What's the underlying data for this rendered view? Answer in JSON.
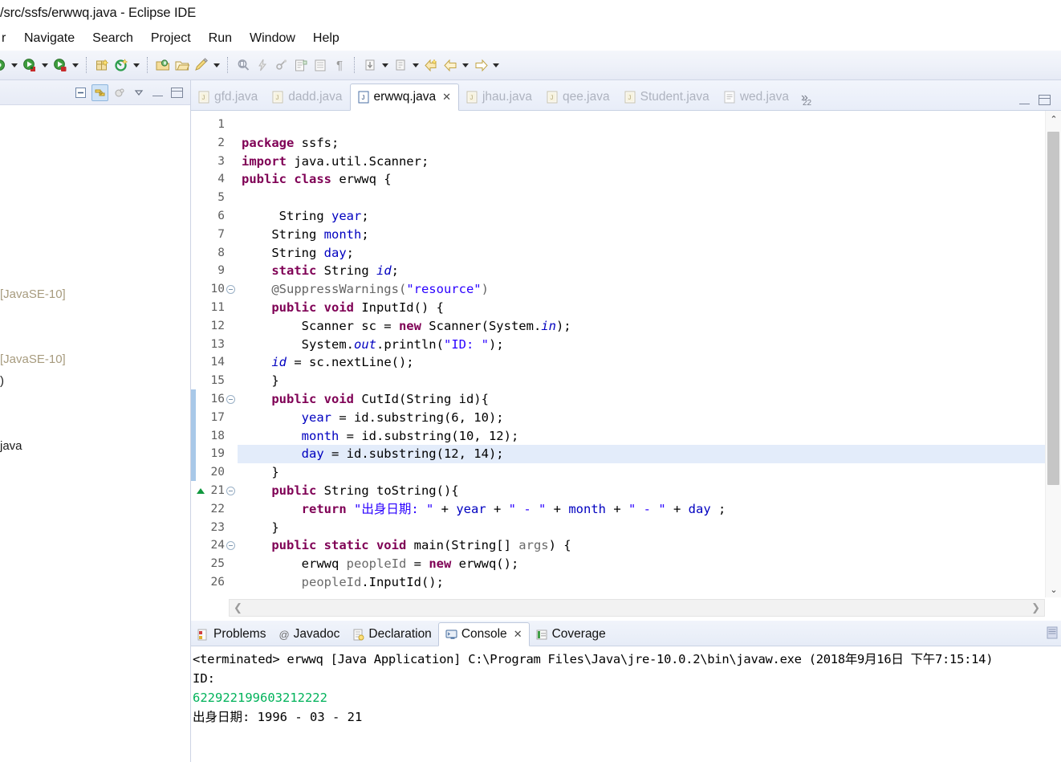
{
  "window": {
    "title": "/src/ssfs/erwwq.java - Eclipse IDE"
  },
  "menubar": {
    "clipped_item": "r",
    "items": [
      {
        "label": "Navigate",
        "name": "menu-navigate"
      },
      {
        "label": "Search",
        "name": "menu-search"
      },
      {
        "label": "Project",
        "name": "menu-project"
      },
      {
        "label": "Run",
        "name": "menu-run"
      },
      {
        "label": "Window",
        "name": "menu-window"
      },
      {
        "label": "Help",
        "name": "menu-help"
      }
    ]
  },
  "toolbar": {
    "icons": [
      "debug-icon",
      "dropdown-arrow",
      "run-icon",
      "dropdown-arrow",
      "run-last-tool-icon",
      "dropdown-arrow",
      "new-package-icon",
      "new-java-class-icon",
      "dropdown-arrow",
      "open-type-icon",
      "open-resource-icon",
      "external-tools-icon",
      "dropdown-arrow",
      "search-icon",
      "lightning-icon",
      "link-icon",
      "next-annotation-icon",
      "previous-annotation-icon",
      "pilcrow-icon",
      "last-edit-location-icon",
      "dropdown-arrow",
      "next-edit-icon",
      "dropdown-arrow",
      "back-icon",
      "forward-back-icon",
      "dropdown-arrow",
      "forward-icon",
      "dropdown-arrow"
    ]
  },
  "left_view": {
    "toolbar_icons": [
      {
        "name": "collapse-all-icon",
        "active": false
      },
      {
        "name": "link-with-editor-icon",
        "active": true
      },
      {
        "name": "focus-on-active-task-icon",
        "active": false
      },
      {
        "name": "view-menu-icon",
        "active": false
      },
      {
        "name": "minimize-icon",
        "active": false
      },
      {
        "name": "maximize-icon",
        "active": false
      }
    ],
    "tree_rows": [
      {
        "label": "",
        "dim": true
      },
      {
        "label": "",
        "dim": true
      },
      {
        "label": "",
        "dim": true
      },
      {
        "label": "",
        "dim": true
      },
      {
        "label": "",
        "dim": true
      },
      {
        "label": "",
        "dim": true
      },
      {
        "label": "",
        "dim": true
      },
      {
        "label": "",
        "dim": true
      },
      {
        "label": "[JavaSE-10]",
        "dim": true
      },
      {
        "label": "",
        "dim": true
      },
      {
        "label": "",
        "dim": true
      },
      {
        "label": "[JavaSE-10]",
        "dim": true
      },
      {
        "label": ")",
        "dim": false
      },
      {
        "label": "",
        "dim": true
      },
      {
        "label": "",
        "dim": true
      },
      {
        "label": "java",
        "dim": false
      }
    ]
  },
  "editor": {
    "tabs": [
      {
        "label": "gfd.java",
        "icon": "java-file-icon",
        "active": false,
        "closeable": false
      },
      {
        "label": "dadd.java",
        "icon": "java-file-icon",
        "active": false,
        "closeable": false
      },
      {
        "label": "erwwq.java",
        "icon": "java-file-icon",
        "active": true,
        "closeable": true,
        "close_glyph": "✕"
      },
      {
        "label": "jhau.java",
        "icon": "java-file-icon",
        "active": false,
        "closeable": false
      },
      {
        "label": "qee.java",
        "icon": "java-file-icon",
        "active": false,
        "closeable": false
      },
      {
        "label": "Student.java",
        "icon": "java-file-icon",
        "active": false,
        "closeable": false
      },
      {
        "label": "wed.java",
        "icon": "text-file-icon",
        "active": false,
        "closeable": false
      }
    ],
    "overflow_label": "»",
    "overflow_count": "22",
    "minimize_icon": "minimize-icon",
    "maximize_icon": "maximize-icon",
    "highlighted_line": 19,
    "change_bar_lines": [
      16,
      17,
      18,
      19,
      20
    ],
    "folding_lines": [
      10,
      16,
      21,
      24
    ],
    "marker_line": 21,
    "lines": [
      {
        "n": 1,
        "tokens": []
      },
      {
        "n": 2,
        "tokens": [
          {
            "t": "kw",
            "v": "package"
          },
          {
            "t": "p",
            "v": " ssfs;"
          }
        ]
      },
      {
        "n": 3,
        "tokens": [
          {
            "t": "kw",
            "v": "import"
          },
          {
            "t": "p",
            "v": " java.util.Scanner;"
          }
        ]
      },
      {
        "n": 4,
        "tokens": [
          {
            "t": "kw",
            "v": "public class"
          },
          {
            "t": "p",
            "v": " erwwq {"
          }
        ]
      },
      {
        "n": 5,
        "tokens": []
      },
      {
        "n": 6,
        "tokens": [
          {
            "t": "p",
            "v": "     String "
          },
          {
            "t": "fld",
            "v": "year"
          },
          {
            "t": "p",
            "v": ";"
          }
        ]
      },
      {
        "n": 7,
        "tokens": [
          {
            "t": "p",
            "v": "    String "
          },
          {
            "t": "fld",
            "v": "month"
          },
          {
            "t": "p",
            "v": ";"
          }
        ]
      },
      {
        "n": 8,
        "tokens": [
          {
            "t": "p",
            "v": "    String "
          },
          {
            "t": "fld",
            "v": "day"
          },
          {
            "t": "p",
            "v": ";"
          }
        ]
      },
      {
        "n": 9,
        "tokens": [
          {
            "t": "p",
            "v": "    "
          },
          {
            "t": "kw",
            "v": "static"
          },
          {
            "t": "p",
            "v": " String "
          },
          {
            "t": "fldi",
            "v": "id"
          },
          {
            "t": "p",
            "v": ";"
          }
        ]
      },
      {
        "n": 10,
        "tokens": [
          {
            "t": "p",
            "v": "    "
          },
          {
            "t": "anno",
            "v": "@SuppressWarnings("
          },
          {
            "t": "str",
            "v": "\"resource\""
          },
          {
            "t": "anno",
            "v": ")"
          }
        ]
      },
      {
        "n": 11,
        "tokens": [
          {
            "t": "p",
            "v": "    "
          },
          {
            "t": "kw",
            "v": "public void"
          },
          {
            "t": "p",
            "v": " InputId() {"
          }
        ]
      },
      {
        "n": 12,
        "tokens": [
          {
            "t": "p",
            "v": "        Scanner sc = "
          },
          {
            "t": "kw",
            "v": "new"
          },
          {
            "t": "p",
            "v": " Scanner(System."
          },
          {
            "t": "fldi",
            "v": "in"
          },
          {
            "t": "p",
            "v": ");"
          }
        ]
      },
      {
        "n": 13,
        "tokens": [
          {
            "t": "p",
            "v": "        System."
          },
          {
            "t": "fldi",
            "v": "out"
          },
          {
            "t": "p",
            "v": ".println("
          },
          {
            "t": "str",
            "v": "\"ID: \""
          },
          {
            "t": "p",
            "v": ");"
          }
        ]
      },
      {
        "n": 14,
        "tokens": [
          {
            "t": "p",
            "v": "    "
          },
          {
            "t": "fldi",
            "v": "id"
          },
          {
            "t": "p",
            "v": " = sc.nextLine();"
          }
        ]
      },
      {
        "n": 15,
        "tokens": [
          {
            "t": "p",
            "v": "    }"
          }
        ]
      },
      {
        "n": 16,
        "tokens": [
          {
            "t": "p",
            "v": "    "
          },
          {
            "t": "kw",
            "v": "public void"
          },
          {
            "t": "p",
            "v": " CutId(String id){"
          }
        ]
      },
      {
        "n": 17,
        "tokens": [
          {
            "t": "p",
            "v": "        "
          },
          {
            "t": "fld",
            "v": "year"
          },
          {
            "t": "p",
            "v": " = id.substring(6, 10);"
          }
        ]
      },
      {
        "n": 18,
        "tokens": [
          {
            "t": "p",
            "v": "        "
          },
          {
            "t": "fld",
            "v": "month"
          },
          {
            "t": "p",
            "v": " = id.substring(10, 12);"
          }
        ]
      },
      {
        "n": 19,
        "tokens": [
          {
            "t": "p",
            "v": "        "
          },
          {
            "t": "fld",
            "v": "day"
          },
          {
            "t": "p",
            "v": " = id.substring(12, 14);"
          }
        ]
      },
      {
        "n": 20,
        "tokens": [
          {
            "t": "p",
            "v": "    }"
          }
        ]
      },
      {
        "n": 21,
        "tokens": [
          {
            "t": "p",
            "v": "    "
          },
          {
            "t": "kw",
            "v": "public"
          },
          {
            "t": "p",
            "v": " String toString(){"
          }
        ]
      },
      {
        "n": 22,
        "tokens": [
          {
            "t": "p",
            "v": "        "
          },
          {
            "t": "kw",
            "v": "return"
          },
          {
            "t": "p",
            "v": " "
          },
          {
            "t": "str",
            "v": "\"出身日期: \""
          },
          {
            "t": "p",
            "v": " + "
          },
          {
            "t": "fld",
            "v": "year"
          },
          {
            "t": "p",
            "v": " + "
          },
          {
            "t": "str",
            "v": "\" - \""
          },
          {
            "t": "p",
            "v": " + "
          },
          {
            "t": "fld",
            "v": "month"
          },
          {
            "t": "p",
            "v": " + "
          },
          {
            "t": "str",
            "v": "\" - \""
          },
          {
            "t": "p",
            "v": " + "
          },
          {
            "t": "fld",
            "v": "day"
          },
          {
            "t": "p",
            "v": " ;"
          }
        ]
      },
      {
        "n": 23,
        "tokens": [
          {
            "t": "p",
            "v": "    }"
          }
        ]
      },
      {
        "n": 24,
        "tokens": [
          {
            "t": "p",
            "v": "    "
          },
          {
            "t": "kw",
            "v": "public static void"
          },
          {
            "t": "p",
            "v": " main(String[] "
          },
          {
            "t": "loc",
            "v": "args"
          },
          {
            "t": "p",
            "v": ") {"
          }
        ]
      },
      {
        "n": 25,
        "tokens": [
          {
            "t": "p",
            "v": "        erwwq "
          },
          {
            "t": "loc",
            "v": "peopleId"
          },
          {
            "t": "p",
            "v": " = "
          },
          {
            "t": "kw",
            "v": "new"
          },
          {
            "t": "p",
            "v": " erwwq();"
          }
        ]
      },
      {
        "n": 26,
        "tokens": [
          {
            "t": "p",
            "v": "        "
          },
          {
            "t": "loc",
            "v": "peopleId"
          },
          {
            "t": "p",
            "v": ".InputId();"
          }
        ]
      }
    ],
    "hscroll": {
      "left_glyph": "❮",
      "right_glyph": "❯"
    },
    "vscroll": {
      "up_glyph": "⌃",
      "down_glyph": "⌄"
    }
  },
  "bottom_panel": {
    "tabs": [
      {
        "label": "Problems",
        "icon": "problems-icon",
        "active": false,
        "closeable": false
      },
      {
        "label": "Javadoc",
        "icon": "javadoc-icon",
        "active": false,
        "closeable": false
      },
      {
        "label": "Declaration",
        "icon": "declaration-icon",
        "active": false,
        "closeable": false
      },
      {
        "label": "Console",
        "icon": "console-icon",
        "active": true,
        "closeable": true,
        "close_glyph": "✕"
      },
      {
        "label": "Coverage",
        "icon": "coverage-icon",
        "active": false,
        "closeable": false
      }
    ],
    "console": {
      "header": "<terminated> erwwq [Java Application] C:\\Program Files\\Java\\jre-10.0.2\\bin\\javaw.exe (2018年9月16日 下午7:15:14)",
      "lines": [
        {
          "text": "ID:",
          "style": "plain"
        },
        {
          "text": "622922199603212222",
          "style": "input-green"
        },
        {
          "text": "出身日期: 1996 - 03 - 21",
          "style": "plain"
        }
      ]
    }
  },
  "colors": {
    "keyword": "#7f0055",
    "string": "#2a00ff",
    "field": "#0000c0",
    "annotation": "#646464",
    "console_input": "#00b25a",
    "highlight_line": "#e3ecfa",
    "change_bar": "#a8c8e8",
    "marker_green": "#10983e"
  }
}
